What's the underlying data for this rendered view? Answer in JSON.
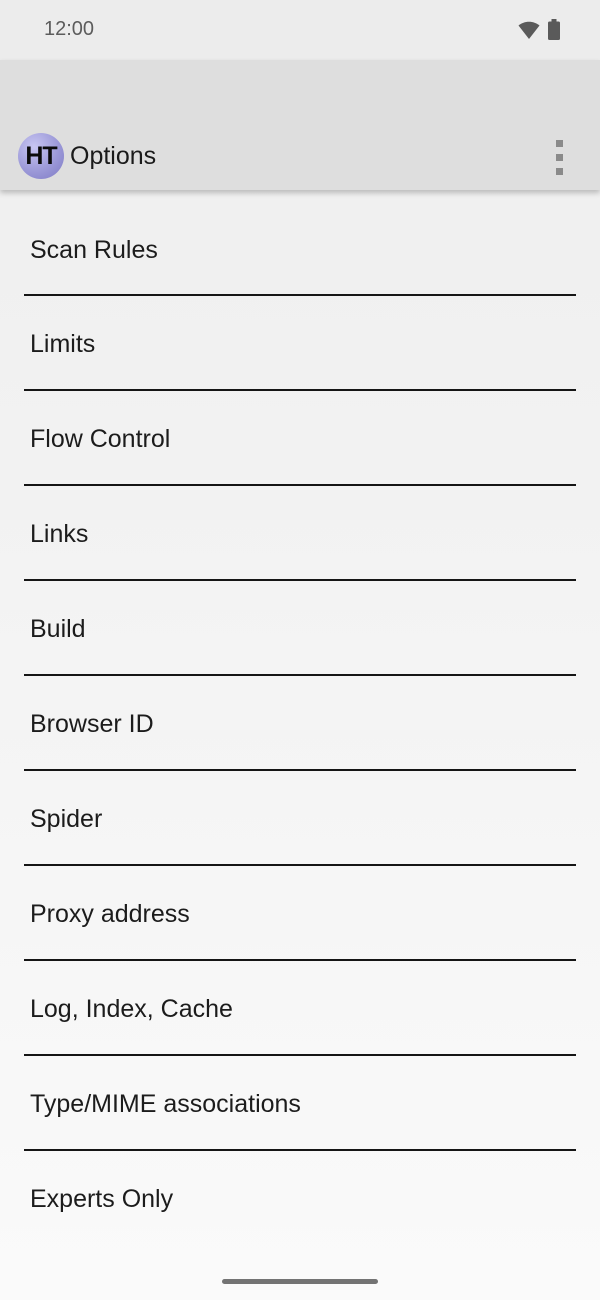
{
  "status_bar": {
    "time": "12:00",
    "icons": [
      "wifi-icon",
      "battery-icon"
    ]
  },
  "app_bar": {
    "logo_text": "HT",
    "title": "Options",
    "menu_icon": "more-vertical-icon"
  },
  "options": [
    {
      "label": "Scan Rules"
    },
    {
      "label": "Limits"
    },
    {
      "label": "Flow Control"
    },
    {
      "label": "Links"
    },
    {
      "label": "Build"
    },
    {
      "label": "Browser ID"
    },
    {
      "label": "Spider"
    },
    {
      "label": "Proxy address"
    },
    {
      "label": "Log, Index, Cache"
    },
    {
      "label": "Type/MIME associations"
    },
    {
      "label": "Experts Only"
    }
  ],
  "colors": {
    "app_bar": "#dedede",
    "status_bar": "#ececec",
    "divider": "#151515",
    "logo": "#9c99d8"
  }
}
